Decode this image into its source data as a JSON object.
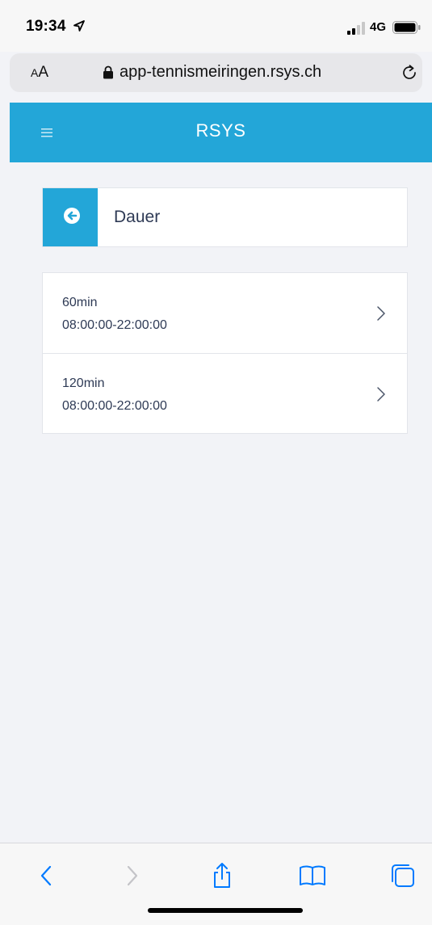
{
  "status_bar": {
    "time": "19:34",
    "network": "4G"
  },
  "browser": {
    "text_size_label_small": "A",
    "text_size_label_large": "A",
    "url": "app-tennismeiringen.rsys.ch"
  },
  "header": {
    "title": "RSYS"
  },
  "page": {
    "title": "Dauer"
  },
  "options": [
    {
      "duration": "60min",
      "time_range": "08:00:00-22:00:00"
    },
    {
      "duration": "120min",
      "time_range": "08:00:00-22:00:00"
    }
  ],
  "colors": {
    "accent": "#23a6d8",
    "text": "#2e3a55",
    "background": "#f2f3f7",
    "ios_blue": "#007aff"
  },
  "icons": [
    "location-arrow-icon",
    "signal-icon",
    "battery-icon",
    "lock-icon",
    "reload-icon",
    "menu-icon",
    "arrow-left-circle-icon",
    "chevron-right-icon",
    "back-icon",
    "forward-icon",
    "share-icon",
    "bookmarks-icon",
    "tabs-icon"
  ]
}
